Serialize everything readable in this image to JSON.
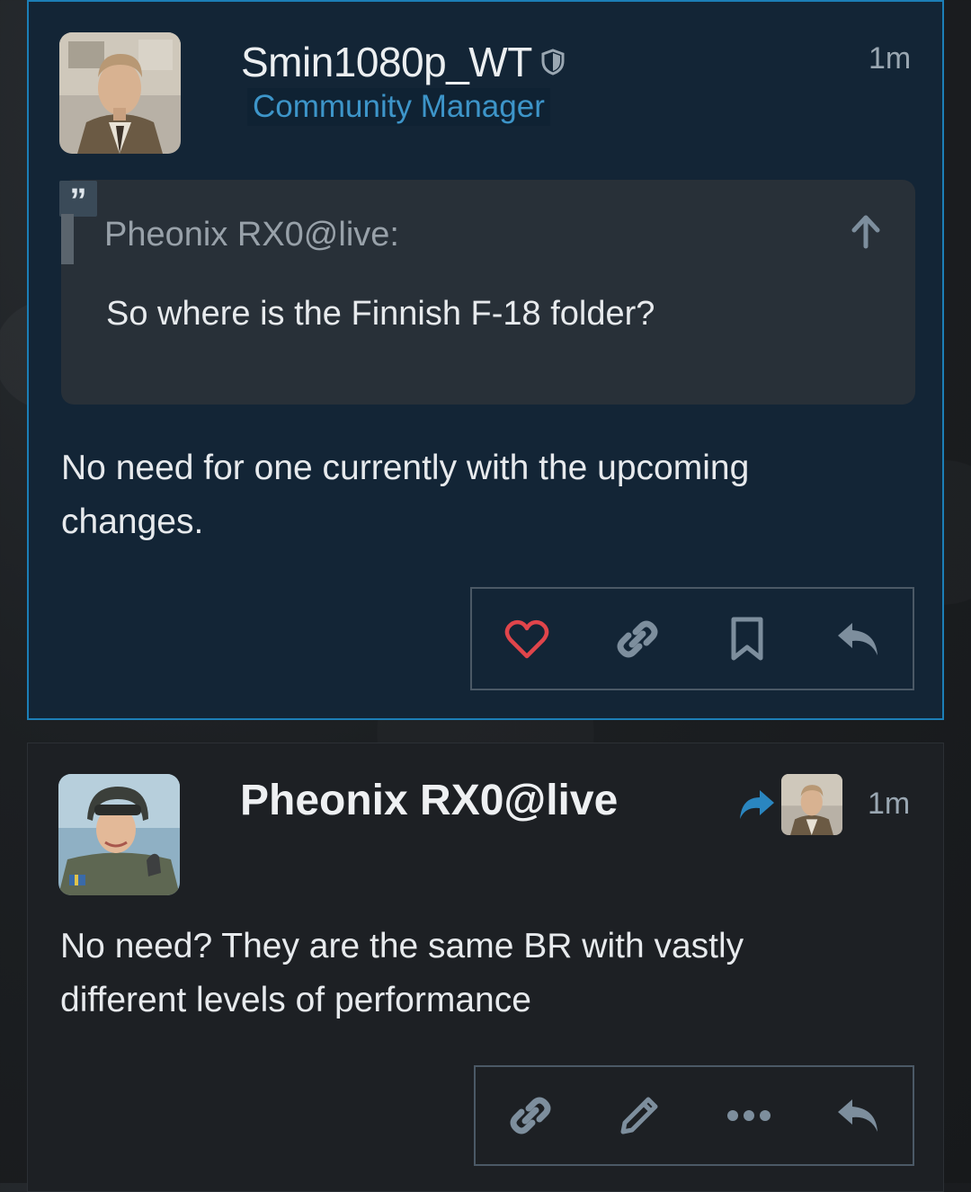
{
  "posts": [
    {
      "username": "Smin1080p_WT",
      "user_title": "Community Manager",
      "time": "1m",
      "quote": {
        "marker": "”",
        "author": "Pheonix RX0@live:",
        "text": "So where is the Finnish F-18 folder?"
      },
      "body": "No need for one currently with the upcoming changes.",
      "actions": [
        "like-icon",
        "link-icon",
        "bookmark-icon",
        "reply-icon"
      ]
    },
    {
      "username": "Pheonix RX0@live",
      "time": "1m",
      "body": "No need? They are the same BR with vastly different levels of performance",
      "actions": [
        "link-icon",
        "edit-icon",
        "more-icon",
        "reply-icon"
      ]
    }
  ],
  "colors": {
    "accent": "#1c7fb7",
    "title": "#3d95c9",
    "like": "#e0454b",
    "icon": "#7d8e9d"
  }
}
